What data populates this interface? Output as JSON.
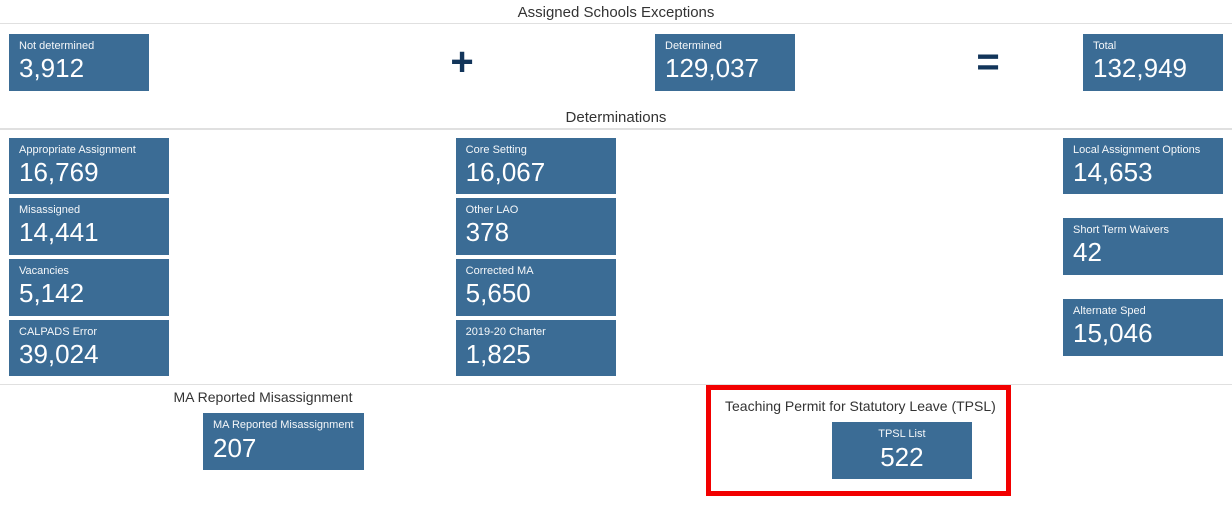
{
  "section1": {
    "title": "Assigned Schools Exceptions",
    "not_determined": {
      "label": "Not determined",
      "value": "3,912"
    },
    "determined": {
      "label": "Determined",
      "value": "129,037"
    },
    "total": {
      "label": "Total",
      "value": "132,949"
    },
    "op1": "+",
    "op2": "="
  },
  "section2": {
    "title": "Determinations",
    "col1": [
      {
        "label": "Appropriate Assignment",
        "value": "16,769"
      },
      {
        "label": "Misassigned",
        "value": "14,441"
      },
      {
        "label": "Vacancies",
        "value": "5,142"
      },
      {
        "label": "CALPADS Error",
        "value": "39,024"
      }
    ],
    "col2": [
      {
        "label": "Core Setting",
        "value": "16,067"
      },
      {
        "label": "Other LAO",
        "value": "378"
      },
      {
        "label": "Corrected MA",
        "value": "5,650"
      },
      {
        "label": "2019-20 Charter",
        "value": "1,825"
      }
    ],
    "col3": [
      {
        "label": "Local Assignment Options",
        "value": "14,653"
      },
      {
        "label": "Short Term Waivers",
        "value": "42"
      },
      {
        "label": "Alternate Sped",
        "value": "15,046"
      }
    ]
  },
  "section3": {
    "left": {
      "title": "MA Reported Misassignment",
      "card": {
        "label": "MA Reported Misassignment",
        "value": "207"
      }
    },
    "right": {
      "title": "Teaching Permit for Statutory Leave (TPSL)",
      "card": {
        "label": "TPSL List",
        "value": "522"
      }
    }
  },
  "chart_data": {
    "type": "table",
    "groups": [
      {
        "name": "Assigned Schools Exceptions",
        "rows": [
          {
            "Not determined": 3912,
            "Determined": 129037,
            "Total": 132949
          }
        ]
      },
      {
        "name": "Determinations",
        "rows": [
          {
            "metric": "Appropriate Assignment",
            "value": 16769
          },
          {
            "metric": "Misassigned",
            "value": 14441
          },
          {
            "metric": "Vacancies",
            "value": 5142
          },
          {
            "metric": "CALPADS Error",
            "value": 39024
          },
          {
            "metric": "Core Setting",
            "value": 16067
          },
          {
            "metric": "Other LAO",
            "value": 378
          },
          {
            "metric": "Corrected MA",
            "value": 5650
          },
          {
            "metric": "2019-20 Charter",
            "value": 1825
          },
          {
            "metric": "Local Assignment Options",
            "value": 14653
          },
          {
            "metric": "Short Term Waivers",
            "value": 42
          },
          {
            "metric": "Alternate Sped",
            "value": 15046
          }
        ]
      },
      {
        "name": "MA Reported Misassignment",
        "rows": [
          {
            "metric": "MA Reported Misassignment",
            "value": 207
          }
        ]
      },
      {
        "name": "Teaching Permit for Statutory Leave (TPSL)",
        "rows": [
          {
            "metric": "TPSL List",
            "value": 522
          }
        ]
      }
    ]
  }
}
